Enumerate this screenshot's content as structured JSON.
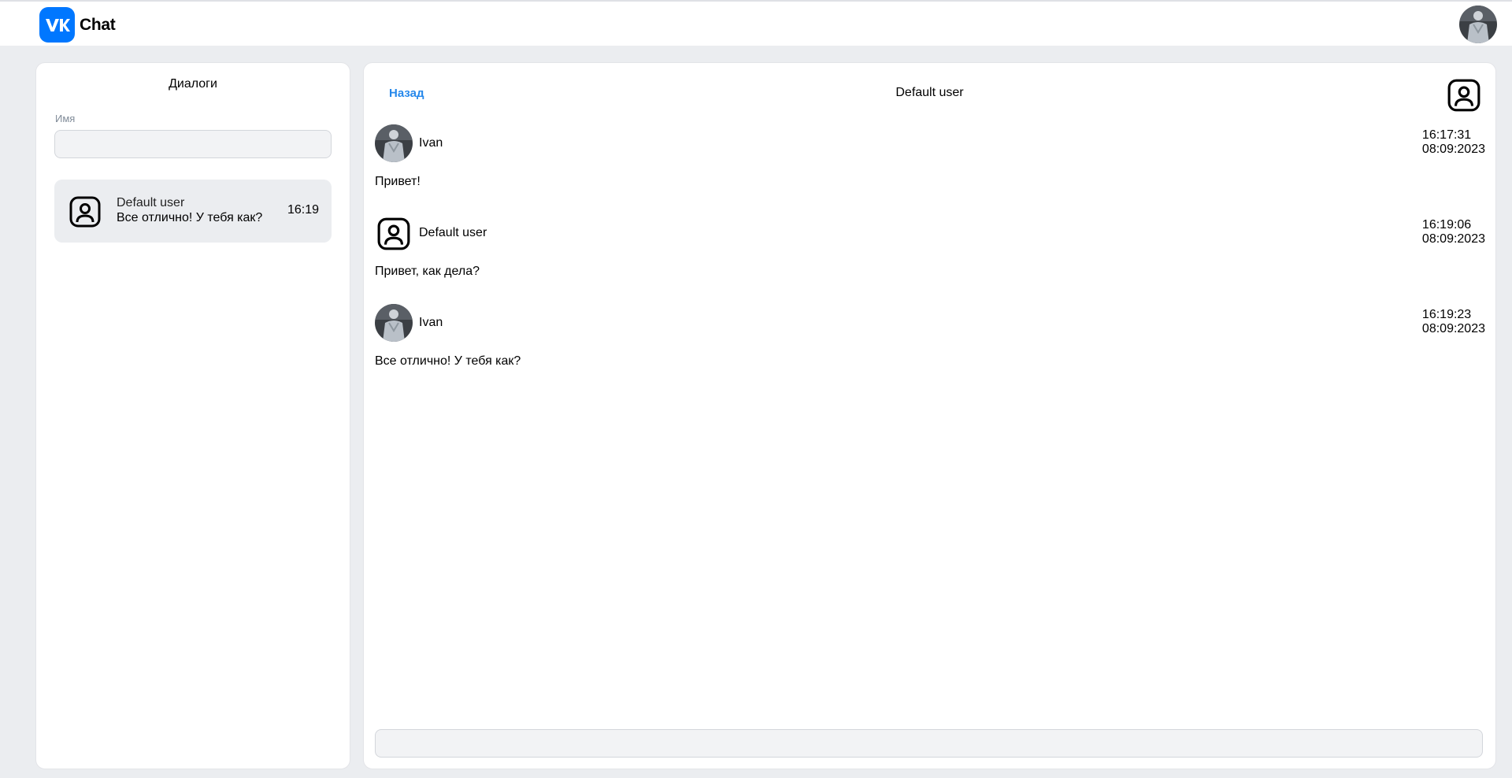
{
  "header": {
    "brand_title": "Chat",
    "logo_icon": "vk-logo-icon",
    "accent": "#0077ff"
  },
  "dialogs": {
    "title": "Диалоги",
    "search_label": "Имя",
    "search_value": "",
    "items": [
      {
        "name": "Default user",
        "last_message": "Все отлично! У тебя как?",
        "time": "16:19",
        "icon": "user-profile-icon"
      }
    ]
  },
  "chat": {
    "back_label": "Назад",
    "title": "Default user",
    "profile_icon": "user-profile-icon",
    "link_color": "#2688eb",
    "messages": [
      {
        "author": "Ivan",
        "time": "16:17:31",
        "date": "08:09:2023",
        "text": "Привет!",
        "avatar": "photo"
      },
      {
        "author": "Default user",
        "time": "16:19:06",
        "date": "08:09:2023",
        "text": "Привет, как дела?",
        "avatar": "user-profile-icon"
      },
      {
        "author": "Ivan",
        "time": "16:19:23",
        "date": "08:09:2023",
        "text": "Все отлично! У тебя как?",
        "avatar": "photo"
      }
    ],
    "input_value": ""
  }
}
